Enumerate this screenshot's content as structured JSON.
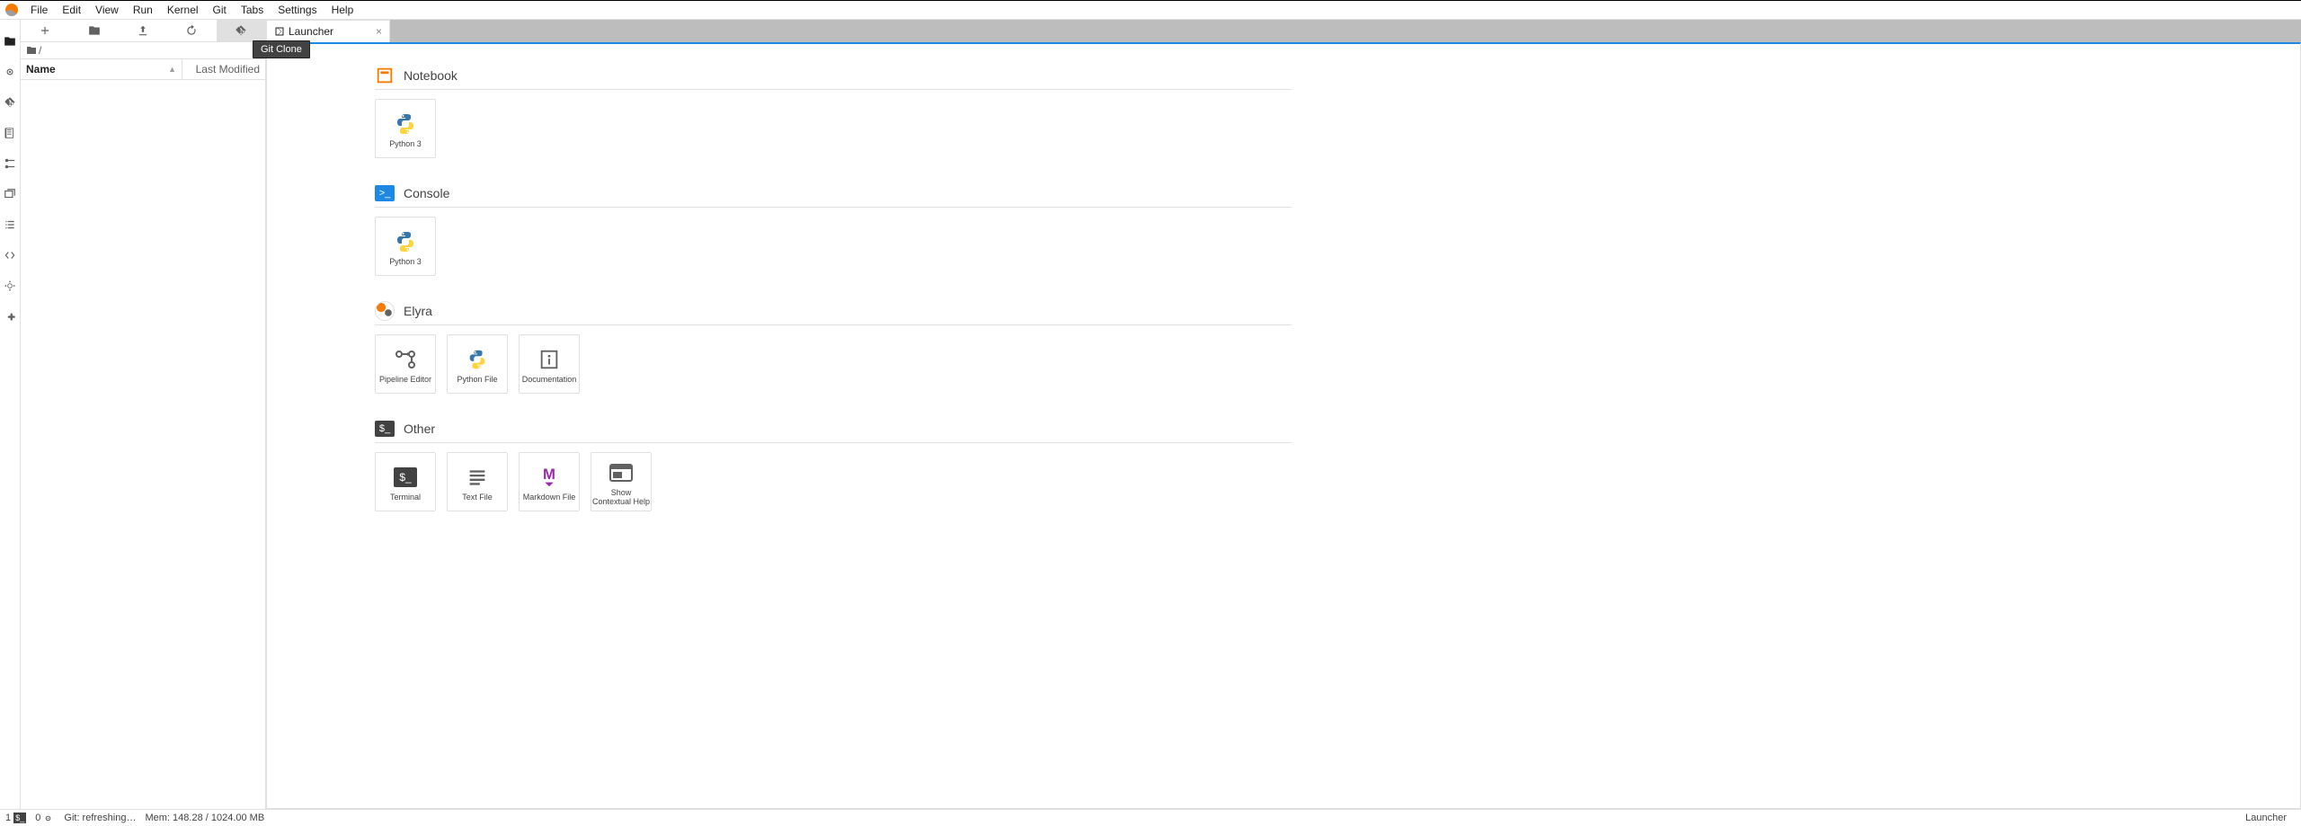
{
  "menu": {
    "items": [
      "File",
      "Edit",
      "View",
      "Run",
      "Kernel",
      "Git",
      "Tabs",
      "Settings",
      "Help"
    ]
  },
  "tooltip": "Git Clone",
  "breadcrumb": "/",
  "file_columns": {
    "name": "Name",
    "modified": "Last Modified"
  },
  "tab": {
    "title": "Launcher"
  },
  "sections": [
    {
      "key": "notebook",
      "title": "Notebook",
      "icon": "notebook",
      "cards": [
        {
          "icon": "python",
          "label": "Python 3"
        }
      ]
    },
    {
      "key": "console",
      "title": "Console",
      "icon": "console",
      "cards": [
        {
          "icon": "python",
          "label": "Python 3"
        }
      ]
    },
    {
      "key": "elyra",
      "title": "Elyra",
      "icon": "elyra",
      "cards": [
        {
          "icon": "pipeline",
          "label": "Pipeline Editor"
        },
        {
          "icon": "pythonfile",
          "label": "Python File"
        },
        {
          "icon": "doc",
          "label": "Documentation"
        }
      ]
    },
    {
      "key": "other",
      "title": "Other",
      "icon": "terminal-sm",
      "cards": [
        {
          "icon": "terminal",
          "label": "Terminal"
        },
        {
          "icon": "text",
          "label": "Text File"
        },
        {
          "icon": "markdown",
          "label": "Markdown File"
        },
        {
          "icon": "contextual",
          "label": "Show Contextual Help"
        }
      ]
    }
  ],
  "status": {
    "terminals": "1",
    "kernels": "0",
    "git": "Git: refreshing…",
    "mem": "Mem: 148.28 / 1024.00 MB",
    "mode": "Launcher"
  }
}
